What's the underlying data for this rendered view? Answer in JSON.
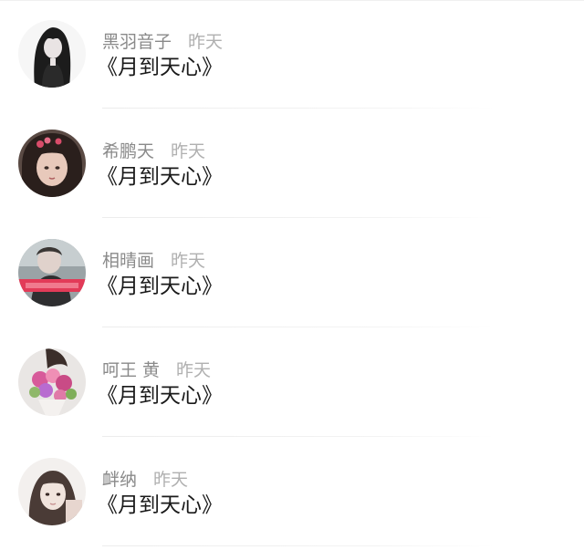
{
  "comments": [
    {
      "name": "黑羽音子",
      "time": "昨天",
      "text": "《月到天心》",
      "avatar": "avatar-dark-anime-girl"
    },
    {
      "name": "希鹏天",
      "time": "昨天",
      "text": "《月到天心》",
      "avatar": "avatar-girl-hairclips"
    },
    {
      "name": "相晴画",
      "time": "昨天",
      "text": "《月到天心》",
      "avatar": "avatar-girl-red-banner"
    },
    {
      "name": "呵王 黄",
      "time": "昨天",
      "text": "《月到天心》",
      "avatar": "avatar-flower-bouquet"
    },
    {
      "name": "衅纳",
      "time": "昨天",
      "text": "《月到天心》",
      "avatar": "avatar-girl-light"
    }
  ]
}
